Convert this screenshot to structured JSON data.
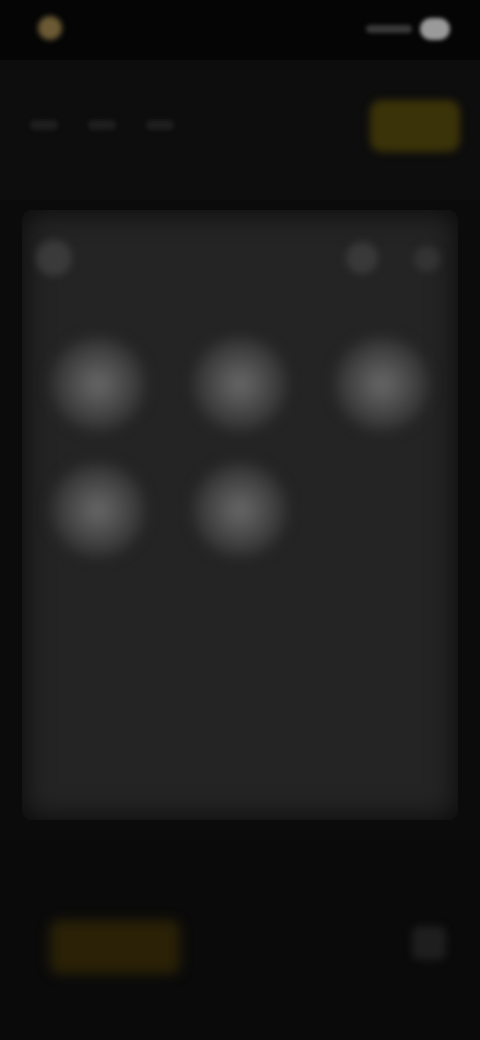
{
  "status_bar": {
    "app_label": "",
    "logo_icon": "app-logo-icon",
    "signal_icon": "signal-icon",
    "battery_icon": "battery-icon"
  },
  "toolbar": {
    "nav_items": [
      "",
      "",
      ""
    ],
    "mid_label": "",
    "action_label": "",
    "accent_color": "#3a3208"
  },
  "panel": {
    "title": "",
    "back_icon": "back-arrow-icon",
    "icon_a": "circle-icon",
    "icon_b": "more-icon",
    "background": "#242424"
  },
  "grid": {
    "tiles": [
      {
        "label": ""
      },
      {
        "label": ""
      },
      {
        "label": ""
      },
      {
        "label": ""
      },
      {
        "label": ""
      }
    ]
  },
  "bottom_bar": {
    "promo_label": "",
    "promo_text": "",
    "menu_icon": "menu-icon",
    "accent_color": "#2a2106"
  }
}
